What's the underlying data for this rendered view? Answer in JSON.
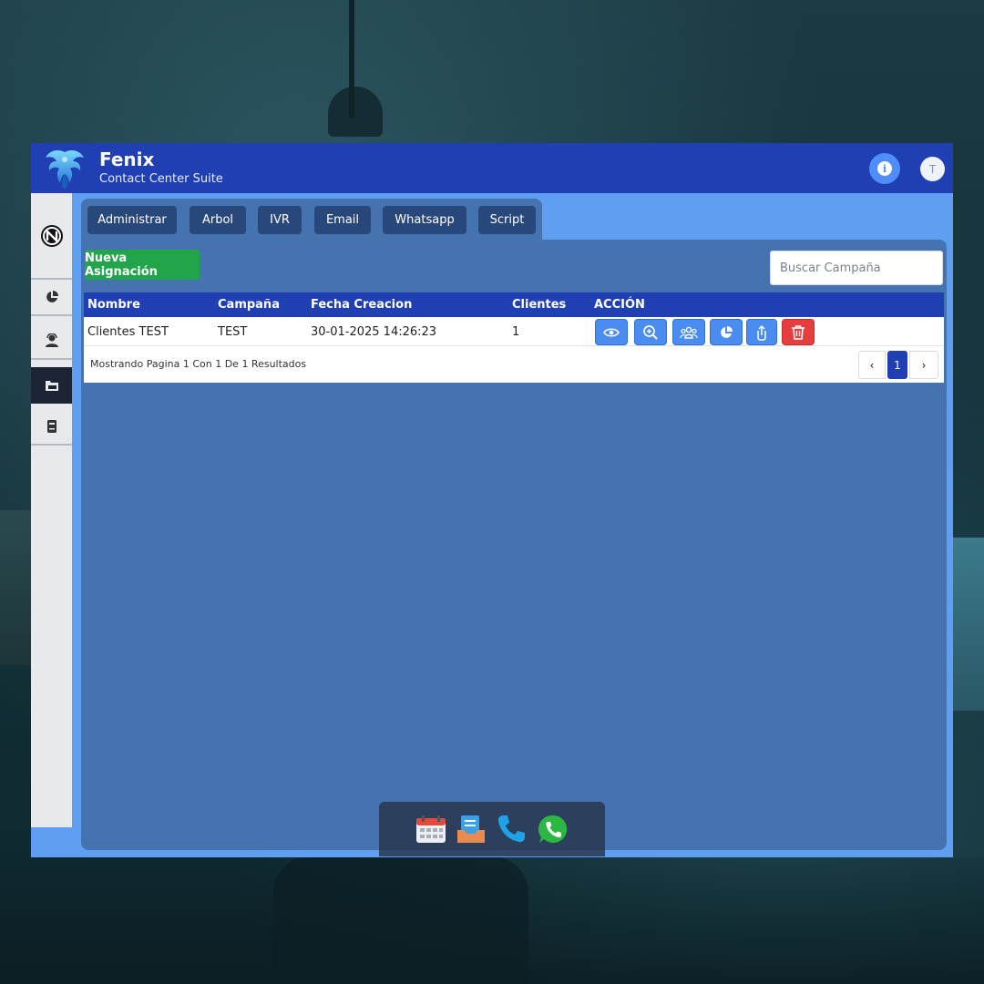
{
  "app": {
    "title": "Fenix",
    "subtitle": "Contact Center Suite",
    "avatar_initial": "T",
    "info_glyph": "i"
  },
  "sidebar": {
    "items": [
      {
        "icon": "brand-logo-icon"
      },
      {
        "icon": "pie-chart-icon"
      },
      {
        "icon": "agent-icon"
      },
      {
        "icon": "folder-icon",
        "active": true
      },
      {
        "icon": "book-icon"
      }
    ]
  },
  "tabs": [
    "Administrar",
    "Arbol",
    "IVR",
    "Email",
    "Whatsapp",
    "Script"
  ],
  "toolbar": {
    "new_button": "Nueva Asignación",
    "search_placeholder": "Buscar Campaña"
  },
  "table": {
    "headers": [
      "Nombre",
      "Campaña",
      "Fecha Creacion",
      "Clientes",
      "ACCIÓN"
    ],
    "rows": [
      {
        "nombre": "Clientes TEST",
        "campana": "TEST",
        "fecha": "30-01-2025 14:26:23",
        "clientes": "1"
      }
    ],
    "actions": [
      "eye-icon",
      "zoom-in-icon",
      "users-icon",
      "pie-chart-icon",
      "upload-icon",
      "trash-icon"
    ],
    "footer": "Mostrando Pagina 1 Con 1 De 1 Resultados",
    "pager": {
      "prev": "‹",
      "current": "1",
      "next": "›"
    }
  },
  "dock": [
    "calendar-icon",
    "inbox-icon",
    "phone-icon",
    "whatsapp-icon"
  ],
  "colors": {
    "topbar": "#1f3fb2",
    "panel": "#4573b0",
    "accent_blue": "#4a8cf0",
    "success": "#21a44a",
    "danger": "#e63e3e"
  }
}
